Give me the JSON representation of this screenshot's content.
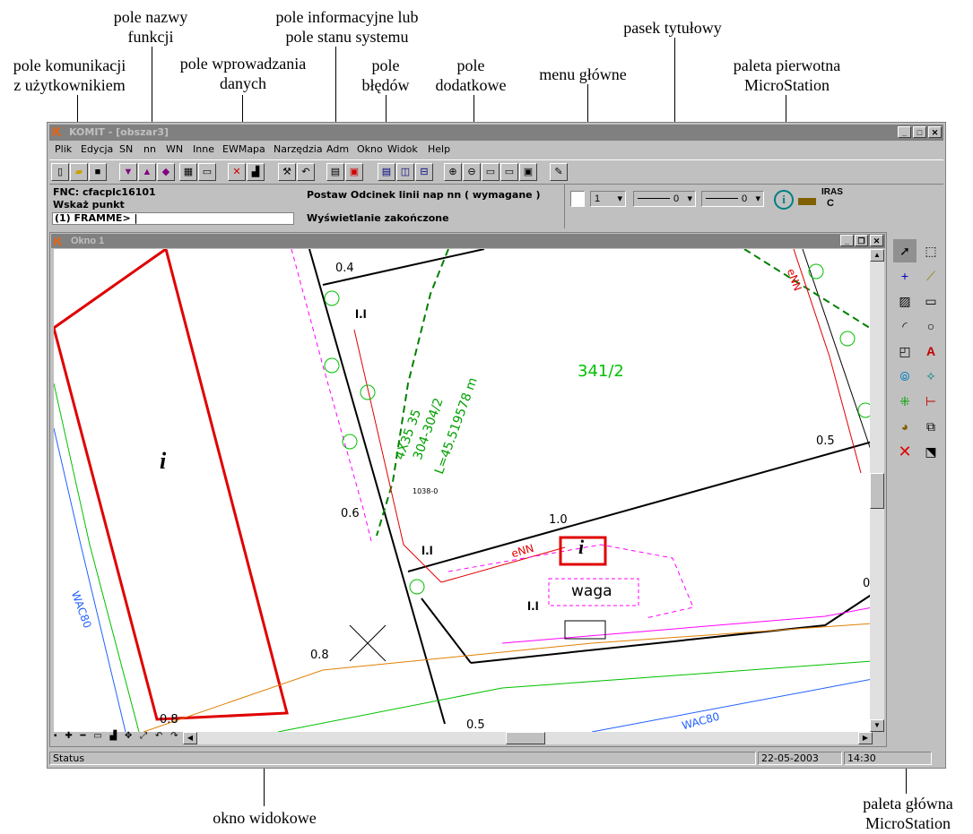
{
  "annotations": {
    "function_name_field": "pole nazwy\nfunkcji",
    "info_status_field": "pole informacyjne lub\npole stanu systemu",
    "title_bar": "pasek tytułowy",
    "user_comm_field": "pole komunikacji\nz użytkownikiem",
    "data_input_field": "pole wprowadzania\ndanych",
    "error_field": "pole\nbłędów",
    "extra_field": "pole\ndodatkowe",
    "main_menu": "menu główne",
    "primary_palette": "paleta pierwotna\nMicroStation",
    "view_window": "okno widokowe",
    "main_palette": "paleta główna\nMicroStation"
  },
  "window": {
    "title": "KOMIT - [obszar3]"
  },
  "menu": [
    "Plik",
    "Edycja",
    "SN",
    "nn",
    "WN",
    "Inne",
    "EWMapa",
    "Narzędzia",
    "Adm",
    "Okno",
    "Widok",
    "Help"
  ],
  "status_area": {
    "fnc": "FNC: cfacplc16101",
    "prompt": "Wskaż punkt",
    "input": "(1) FRAMME> |",
    "info": "Postaw Odcinek linii nap nn ( wymagane )",
    "message": "Wyświetlanie zakończone"
  },
  "attributes": {
    "level": "1",
    "style": "0",
    "weight": "0",
    "iras": "IRAS",
    "iras_sub": "C"
  },
  "view": {
    "title": "Okno 1",
    "labels": {
      "parcel": "341/2",
      "dim1": "4X35 35",
      "dim2": "304-304/2",
      "dim3": "L=45.519578 m",
      "waga": "waga",
      "wac1": "WAC80",
      "wac2": "WAC80",
      "small": "1038-0",
      "enn1": "eNN",
      "enn2": "eNN",
      "n04": "0.4",
      "n05a": "0.5",
      "n06": "0.6",
      "n10": "1.0",
      "n08a": "0.8",
      "n08b": "0.8",
      "n05b": "0.5",
      "n0": "0.",
      "ll1": "l.l",
      "ll2": "l.l",
      "ll3": "l.l",
      "i1": "i",
      "i2": "i"
    }
  },
  "statusbar": {
    "status": "Status",
    "date": "22-05-2003",
    "time": "14:30"
  }
}
